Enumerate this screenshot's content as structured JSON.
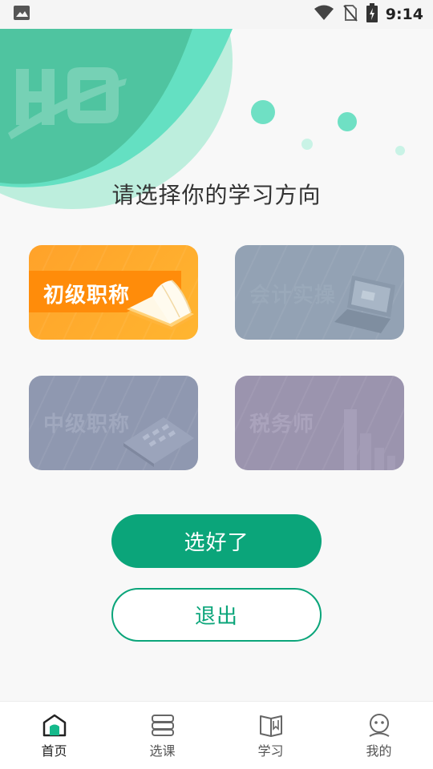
{
  "status_bar": {
    "time": "9:14",
    "icons": [
      "image-icon",
      "wifi-icon",
      "no-sim-icon",
      "battery-charging-icon"
    ]
  },
  "hero": {
    "logo_text": "HQ"
  },
  "prompt": "请选择你的学习方向",
  "cards": [
    {
      "id": "chuji",
      "label": "初级职称",
      "icon": "book-icon",
      "selected": true
    },
    {
      "id": "kuaiji",
      "label": "会计实操",
      "icon": "laptop-icon",
      "selected": false
    },
    {
      "id": "zhongji",
      "label": "中级职称",
      "icon": "calculator-icon",
      "selected": false
    },
    {
      "id": "shuiwu",
      "label": "税务师",
      "icon": "bar-chart-icon",
      "selected": false
    }
  ],
  "buttons": {
    "confirm": "选好了",
    "exit": "退出"
  },
  "tabbar": {
    "items": [
      {
        "label": "首页",
        "icon": "home-icon",
        "active": true
      },
      {
        "label": "选课",
        "icon": "course-stack-icon",
        "active": false
      },
      {
        "label": "学习",
        "icon": "open-book-icon",
        "active": false
      },
      {
        "label": "我的",
        "icon": "profile-icon",
        "active": false
      }
    ]
  },
  "colors": {
    "accent": "#0ba57a",
    "hero_green": "#4fc4a0",
    "card_orange": "#ffa22a",
    "card_slate": "#93a2b4",
    "card_indigo": "#8f98b0",
    "card_purple": "#9b94ae"
  }
}
